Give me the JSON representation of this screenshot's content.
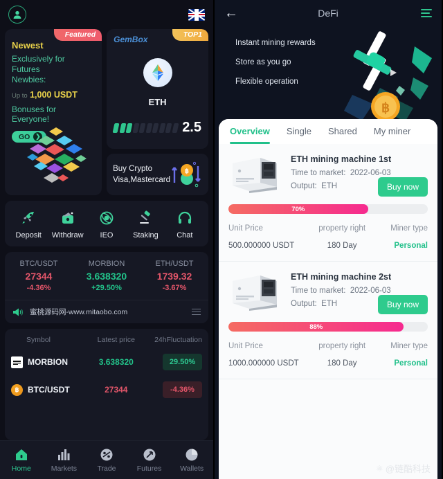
{
  "left_panel": {
    "topbar": {
      "avatar": "avatar-icon",
      "language_flag": "uk-flag"
    },
    "promo_card": {
      "ribbon": "Featured",
      "title": "Newest",
      "line1": "Exclusively for Futures",
      "line2": "Newbies:",
      "upto_prefix": "Up to",
      "amount": "1,000 USDT",
      "bonus": "Bonuses for Everyone!",
      "cta": "GO"
    },
    "gem_card": {
      "label": "GemBox",
      "ribbon": "TOP1",
      "coin": "ETH",
      "value": "2.5",
      "segments_total": 10,
      "segments_filled": 3
    },
    "buy_crypto_card": {
      "line1": "Buy Crypto",
      "line2": "Visa,Mastercard"
    },
    "quick_actions": [
      {
        "label": "Deposit",
        "icon": "rocket-icon"
      },
      {
        "label": "Withdraw",
        "icon": "wallet-icon"
      },
      {
        "label": "IEO",
        "icon": "atom-icon"
      },
      {
        "label": "Staking",
        "icon": "gavel-icon"
      },
      {
        "label": "Chat",
        "icon": "headset-icon"
      }
    ],
    "tickers": [
      {
        "symbol": "BTC/USDT",
        "price": "27344",
        "change": "-4.36%",
        "dir": "down"
      },
      {
        "symbol": "MORBION",
        "price": "3.638320",
        "change": "+29.50%",
        "dir": "up"
      },
      {
        "symbol": "ETH/USDT",
        "price": "1739.32",
        "change": "-3.67%",
        "dir": "down"
      }
    ],
    "notice": {
      "icon": "megaphone-icon",
      "text": "蜜桃源码网-www.mitaobo.com",
      "more_icon": "list-icon"
    },
    "market_table": {
      "headers": [
        "Symbol",
        "Latest price",
        "24hFluctuation"
      ],
      "rows": [
        {
          "symbol": "MORBION",
          "price": "3.638320",
          "change": "29.50%",
          "dir": "up",
          "icon": "morbion-logo"
        },
        {
          "symbol": "BTC/USDT",
          "price": "27344",
          "change": "-4.36%",
          "dir": "down",
          "icon": "btc-logo"
        }
      ]
    },
    "tabbar": [
      {
        "label": "Home",
        "icon": "home-icon",
        "active": true
      },
      {
        "label": "Markets",
        "icon": "bars-icon",
        "active": false
      },
      {
        "label": "Trade",
        "icon": "trade-icon",
        "active": false
      },
      {
        "label": "Futures",
        "icon": "futures-icon",
        "active": false
      },
      {
        "label": "Wallets",
        "icon": "pie-icon",
        "active": false
      }
    ]
  },
  "right_panel": {
    "header": {
      "back": "←",
      "title": "DeFi",
      "menu": "menu-icon"
    },
    "hero": {
      "lines": [
        "Instant mining rewards",
        "Store as you go",
        "Flexible operation"
      ],
      "art": "windmill-coin-illustration"
    },
    "tabs": [
      {
        "label": "Overview",
        "active": true
      },
      {
        "label": "Single",
        "active": false
      },
      {
        "label": "Shared",
        "active": false
      },
      {
        "label": "My miner",
        "active": false
      }
    ],
    "products": [
      {
        "name": "ETH mining machine 1st",
        "time_label": "Time to market:",
        "time_value": "2022-06-03",
        "output_label": "Output:",
        "output_value": "ETH",
        "buy_label": "Buy now",
        "progress_pct": 70,
        "progress_text": "70%",
        "col_headers": [
          "Unit Price",
          "property right",
          "Miner type"
        ],
        "col_values": [
          "500.000000 USDT",
          "180 Day",
          "Personal"
        ]
      },
      {
        "name": "ETH mining machine 2st",
        "time_label": "Time to market:",
        "time_value": "2022-06-03",
        "output_label": "Output:",
        "output_value": "ETH",
        "buy_label": "Buy now",
        "progress_pct": 88,
        "progress_text": "88%",
        "col_headers": [
          "Unit Price",
          "property right",
          "Miner type"
        ],
        "col_values": [
          "1000.000000 USDT",
          "180 Day",
          "Personal"
        ]
      }
    ],
    "watermark": {
      "icon": "weibo-icon",
      "text": "@链酷科技"
    }
  },
  "colors": {
    "accent_green": "#2ecb8d",
    "dark_bg": "#0e0f18",
    "card_bg": "#161824",
    "up": "#22c38a",
    "down": "#e4566a",
    "progress_from": "#f56b62",
    "progress_to": "#f62a8f",
    "gold": "#e8d14a"
  }
}
